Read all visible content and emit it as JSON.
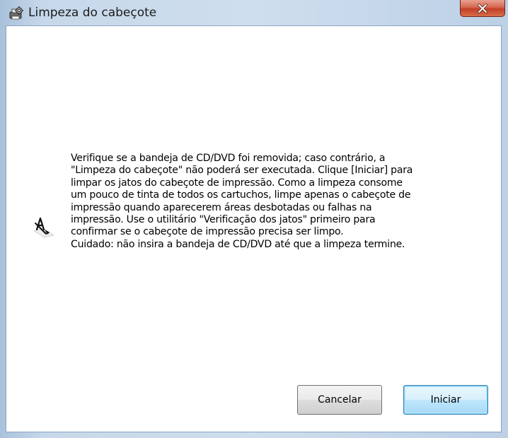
{
  "window": {
    "title": "Limpeza do cabeçote",
    "title_icon": "printer-tool-icon",
    "close_icon": "close-icon"
  },
  "content": {
    "icon": "nozzle-check-icon",
    "message": "Verifique se a bandeja de CD/DVD foi removida; caso contrário, a\n\"Limpeza do cabeçote\" não poderá ser executada. Clique [Iniciar] para\nlimpar os jatos do cabeçote de impressão. Como a limpeza consome\num pouco de tinta de todos os cartuchos, limpe apenas o cabeçote de\nimpressão quando aparecerem áreas desbotadas ou falhas na\nimpressão. Use o utilitário \"Verificação dos jatos\" primeiro para\nconfirmar se o cabeçote de impressão precisa ser limpo.\nCuidado: não insira a bandeja de CD/DVD até que a limpeza termine."
  },
  "buttons": {
    "cancel_label": "Cancelar",
    "start_label": "Iniciar"
  },
  "colors": {
    "close_button": "#c23f27",
    "default_button_border": "#3c7fb1"
  }
}
